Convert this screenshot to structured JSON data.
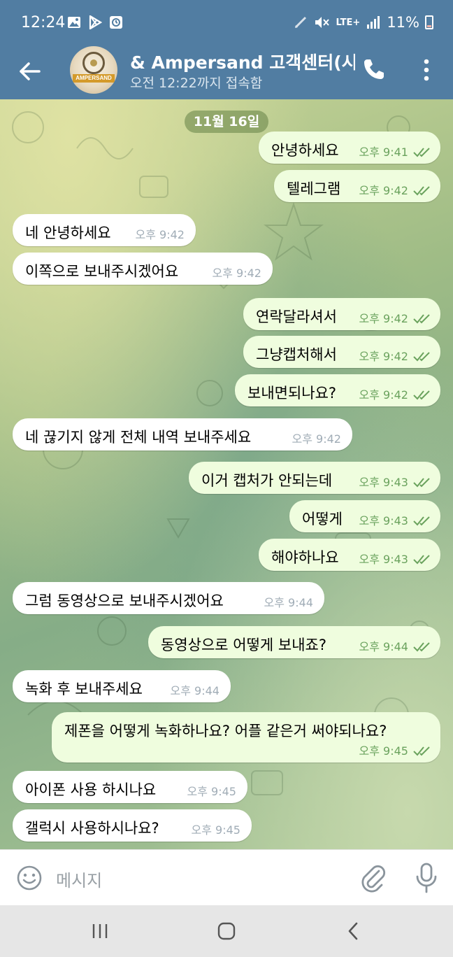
{
  "status_bar": {
    "time": "12:24",
    "network": "LTE+",
    "battery": "11%",
    "icons": [
      "gallery-icon",
      "play-store-icon",
      "alarm-icon",
      "pen-icon",
      "mute-icon",
      "signal-icon",
      "battery-icon"
    ]
  },
  "header": {
    "title": "& Ampersand 고객센터(시",
    "subtitle": "오전 12:22까지 접속함",
    "avatar_text": "AMPERSAND",
    "icons": [
      "back-arrow-icon",
      "phone-icon",
      "more-vertical-icon"
    ]
  },
  "chat": {
    "date_chip": "11월 16일",
    "messages": [
      {
        "dir": "out",
        "text": "안녕하세요",
        "time": "오후 9:41"
      },
      {
        "dir": "out",
        "text": "텔레그램",
        "time": "오후 9:42"
      },
      {
        "dir": "in",
        "text": "네 안녕하세요",
        "time": "오후 9:42"
      },
      {
        "dir": "in",
        "text": "이쪽으로 보내주시겠어요",
        "time": "오후 9:42"
      },
      {
        "dir": "out",
        "text": "연락달라셔서",
        "time": "오후 9:42"
      },
      {
        "dir": "out",
        "text": "그냥캡처해서",
        "time": "오후 9:42"
      },
      {
        "dir": "out",
        "text": "보내면되나요?",
        "time": "오후 9:42"
      },
      {
        "dir": "in",
        "text": "네 끊기지 않게 전체 내역 보내주세요",
        "time": "오후 9:42"
      },
      {
        "dir": "out",
        "text": "이거 캡처가 안되는데",
        "time": "오후 9:43"
      },
      {
        "dir": "out",
        "text": "어떻게",
        "time": "오후 9:43"
      },
      {
        "dir": "out",
        "text": "해야하나요",
        "time": "오후 9:43"
      },
      {
        "dir": "in",
        "text": "그럼 동영상으로 보내주시겠어요",
        "time": "오후 9:44"
      },
      {
        "dir": "out",
        "text": "동영상으로 어떻게 보내죠?",
        "time": "오후 9:44"
      },
      {
        "dir": "in",
        "text": "녹화 후 보내주세요",
        "time": "오후 9:44"
      },
      {
        "dir": "out",
        "text": "제폰을 어떻게 녹화하나요? 어플 같은거 써야되나요?",
        "time": "오후 9:45"
      },
      {
        "dir": "in",
        "text": "아이폰 사용 하시나요",
        "time": "오후 9:45"
      },
      {
        "dir": "in",
        "text": "갤럭시 사용하시나요?",
        "time": "오후 9:45"
      }
    ]
  },
  "input": {
    "placeholder": "메시지",
    "icons": [
      "emoji-icon",
      "paperclip-icon",
      "microphone-icon"
    ]
  },
  "navbar": {
    "icons": [
      "recent-apps-icon",
      "home-icon",
      "nav-back-icon"
    ]
  },
  "colors": {
    "header": "#517da2",
    "outgoing_bubble": "#effdde",
    "incoming_bubble": "#ffffff",
    "outgoing_time": "#6aa25d",
    "incoming_time": "#a0acb6"
  }
}
